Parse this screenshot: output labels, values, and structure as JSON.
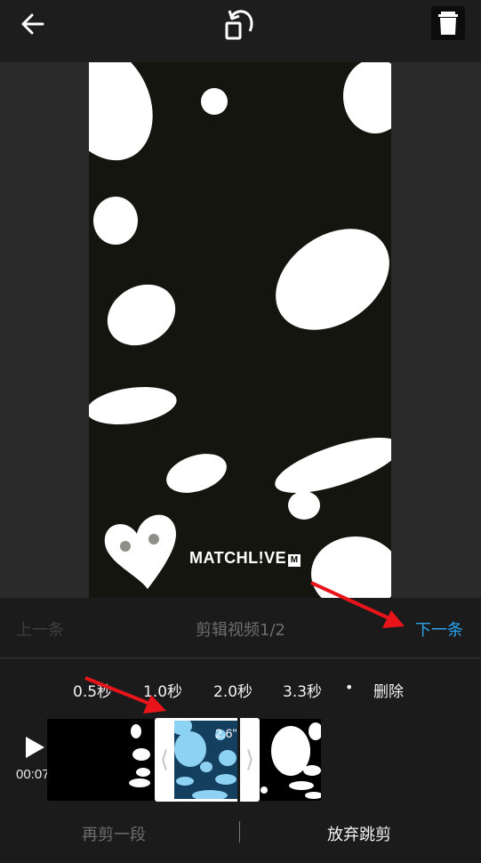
{
  "topbar": {
    "back_icon": "arrow-left-icon",
    "rotate_icon": "rotate-icon",
    "delete_icon": "trash-icon"
  },
  "video": {
    "watermark": "MATCHL!VE",
    "watermark_badge": "M"
  },
  "nav": {
    "prev_label": "上一条",
    "title": "剪辑视频1/2",
    "next_label": "下一条",
    "next_color": "#2aa4f0"
  },
  "durations": {
    "options": [
      "0.5秒",
      "1.0秒",
      "2.0秒",
      "3.3秒"
    ],
    "separator": "•",
    "delete_label": "删除"
  },
  "timeline": {
    "play_icon": "play-icon",
    "time": "00:07",
    "clip_length": "2.6\"",
    "selection_color": "#143f5e"
  },
  "bottom": {
    "cut_again": "再剪一段",
    "abandon": "放弃跳剪"
  },
  "colors": {
    "accent": "#2aa4f0",
    "annotation_arrow": "#e8141a"
  }
}
